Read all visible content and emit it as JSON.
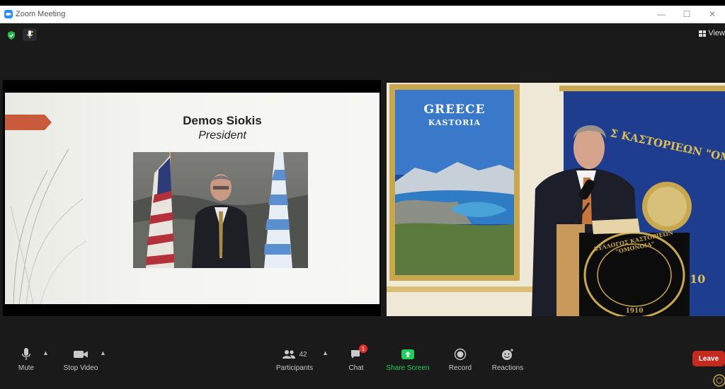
{
  "window": {
    "title": "Zoom Meeting",
    "controls": [
      "—",
      "☐",
      "✕"
    ]
  },
  "header": {
    "view_label": "View"
  },
  "slide": {
    "name": "Demos Siokis",
    "role": "President"
  },
  "poster": {
    "line1": "GREECE",
    "line2": "KASTORIA"
  },
  "banner": {
    "text": "Σ ΚΑΣΤΟΡΙΕΩΝ \"ΟΜΟΝΟΙΑ\"",
    "year_fragment": "10"
  },
  "podium": {
    "seal_text": "ΣΥΛΛΟΓΟΣ ΚΑΣΤΟΡΙΕΩΝ \"ΟΜΟΝΟΙΑ\"",
    "seal_year": "1910"
  },
  "toolbar": {
    "mute": "Mute",
    "stop_video": "Stop Video",
    "participants": "Participants",
    "participants_count": "42",
    "chat": "Chat",
    "chat_badge": "1",
    "share_screen": "Share Screen",
    "record": "Record",
    "reactions": "Reactions",
    "leave": "Leave"
  },
  "colors": {
    "share_green": "#1fcf5c",
    "leave_red": "#c52a1f",
    "arrow_orange": "#c75b3b",
    "banner_blue": "#1f3d8f"
  }
}
